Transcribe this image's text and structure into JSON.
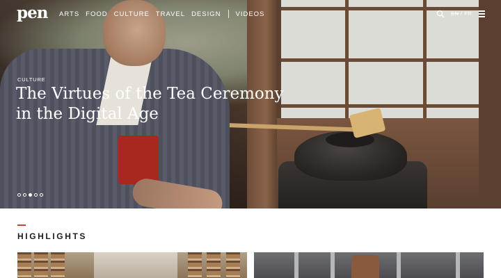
{
  "brand": {
    "logo": "pen"
  },
  "nav": {
    "items": [
      "ARTS",
      "FOOD",
      "CULTURE",
      "TRAVEL",
      "DESIGN"
    ],
    "videos": "VIDEOS",
    "lang_current": "EN",
    "lang_sep": "/",
    "lang_other": "FR"
  },
  "icons": {
    "search": "search-icon",
    "menu": "hamburger-menu-icon"
  },
  "hero": {
    "category": "CULTURE",
    "title": "The Virtues of the Tea Ceremony in the Digital Age",
    "slides_total": 5,
    "slide_active_index": 3
  },
  "highlights": {
    "heading": "HIGHLIGHTS"
  },
  "colors": {
    "accent": "#c4473b",
    "text": "#1c1c1c",
    "nav_text": "#ffffff"
  }
}
